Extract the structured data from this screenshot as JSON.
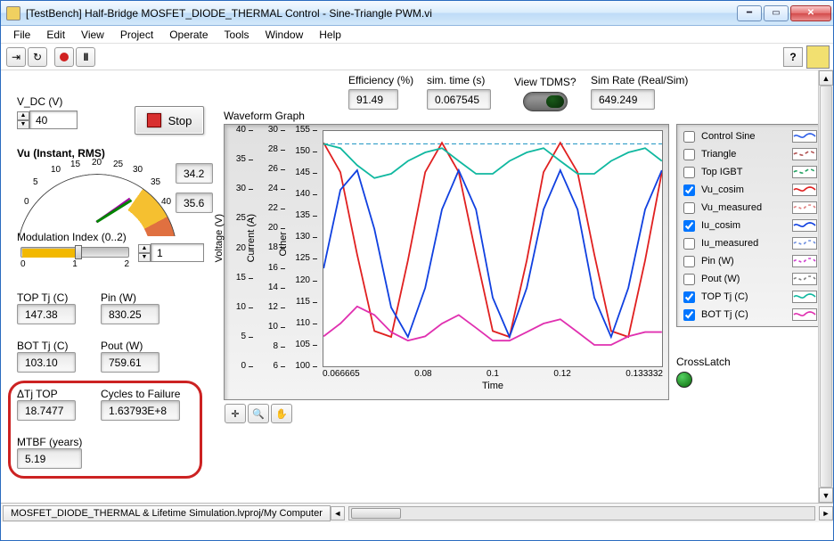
{
  "window": {
    "title": "[TestBench] Half-Bridge MOSFET_DIODE_THERMAL Control - Sine-Triangle PWM.vi"
  },
  "menu": [
    "File",
    "Edit",
    "View",
    "Project",
    "Operate",
    "Tools",
    "Window",
    "Help"
  ],
  "header": {
    "eff_label": "Efficiency (%)",
    "eff": "91.49",
    "simt_label": "sim. time (s)",
    "simt": "0.067545",
    "tdms_label": "View TDMS?",
    "rate_label": "Sim Rate (Real/Sim)",
    "rate": "649.249"
  },
  "left": {
    "vdc_label": "V_DC (V)",
    "vdc": "40",
    "stop": "Stop",
    "vu_title": "Vu (Instant, RMS)",
    "vu_a": "34.2",
    "vu_b": "35.6",
    "gauge_ticks": [
      "0",
      "5",
      "10",
      "15",
      "20",
      "25",
      "30",
      "35",
      "40"
    ],
    "mi_label": "Modulation Index (0..2)",
    "mi": "1",
    "mi_ticks": [
      "0",
      "1",
      "2"
    ],
    "toptj_label": "TOP Tj (C)",
    "toptj": "147.38",
    "pin_label": "Pin (W)",
    "pin": "830.25",
    "bottj_label": "BOT Tj (C)",
    "bottj": "103.10",
    "pout_label": "Pout (W)",
    "pout": "759.61",
    "dtj_label": "ΔTj TOP",
    "dtj": "18.7477",
    "cycles_label": "Cycles to Failure",
    "cycles": "1.63793E+8",
    "mtbf_label": "MTBF (years)",
    "mtbf": "5.19"
  },
  "graph": {
    "title": "Waveform Graph",
    "y1_name": "Voltage (V)",
    "y1": [
      "40",
      "35",
      "30",
      "25",
      "20",
      "15",
      "10",
      "5",
      "0"
    ],
    "y2_name": "Current (A)",
    "y2": [
      "30",
      "28",
      "26",
      "24",
      "22",
      "20",
      "18",
      "16",
      "14",
      "12",
      "10",
      "8",
      "6"
    ],
    "y3_name": "Other",
    "y3": [
      "155",
      "150",
      "145",
      "140",
      "135",
      "130",
      "125",
      "120",
      "115",
      "110",
      "105",
      "100"
    ],
    "xticks": [
      "0.066665",
      "0.08",
      "0.1",
      "0.12",
      "0.133332"
    ],
    "xlabel": "Time",
    "crosslatch_label": "CrossLatch"
  },
  "legend": [
    {
      "name": "Control Sine",
      "checked": false,
      "col": "#3060e8",
      "dash": ""
    },
    {
      "name": "Triangle",
      "checked": false,
      "col": "#b05050",
      "dash": "4 3"
    },
    {
      "name": "Top IGBT",
      "checked": false,
      "col": "#20a060",
      "dash": "4 3"
    },
    {
      "name": "Vu_cosim",
      "checked": true,
      "col": "#e02020",
      "dash": ""
    },
    {
      "name": "Vu_measured",
      "checked": false,
      "col": "#e08080",
      "dash": "3 3"
    },
    {
      "name": "Iu_cosim",
      "checked": true,
      "col": "#1040e0",
      "dash": ""
    },
    {
      "name": "Iu_measured",
      "checked": false,
      "col": "#7090e0",
      "dash": "3 3"
    },
    {
      "name": "Pin (W)",
      "checked": false,
      "col": "#d040d0",
      "dash": "3 3"
    },
    {
      "name": "Pout (W)",
      "checked": false,
      "col": "#808080",
      "dash": "3 3"
    },
    {
      "name": "TOP Tj (C)",
      "checked": true,
      "col": "#10b8a0",
      "dash": ""
    },
    {
      "name": "BOT Tj (C)",
      "checked": true,
      "col": "#e030b0",
      "dash": ""
    }
  ],
  "status": "MOSFET_DIODE_THERMAL & Lifetime Simulation.lvproj/My Computer",
  "chart_data": {
    "type": "line",
    "xlabel": "Time",
    "xlim": [
      0.066665,
      0.133332
    ],
    "axes": [
      {
        "name": "Voltage (V)",
        "range": [
          0,
          40
        ]
      },
      {
        "name": "Current (A)",
        "range": [
          6,
          30
        ]
      },
      {
        "name": "Other",
        "range": [
          100,
          155
        ]
      }
    ],
    "x": [
      0.0667,
      0.07,
      0.0733,
      0.0767,
      0.08,
      0.0833,
      0.0867,
      0.09,
      0.0933,
      0.0967,
      0.1,
      0.1033,
      0.1067,
      0.11,
      0.1133,
      0.1167,
      0.12,
      0.1233,
      0.1267,
      0.13,
      0.1333
    ],
    "series": [
      {
        "name": "Vu_cosim",
        "axis": 0,
        "y": [
          38,
          33,
          19,
          6,
          5,
          18,
          33,
          38,
          33,
          19,
          6,
          5,
          18,
          33,
          38,
          33,
          19,
          6,
          5,
          18,
          33
        ]
      },
      {
        "name": "Iu_cosim",
        "axis": 1,
        "y": [
          16,
          24,
          26,
          20,
          12,
          9,
          14,
          22,
          26,
          22,
          13,
          9,
          14,
          22,
          26,
          22,
          13,
          9,
          14,
          22,
          26
        ]
      },
      {
        "name": "TOP Tj (C)",
        "axis": 2,
        "y": [
          152,
          151,
          147,
          144,
          145,
          148,
          150,
          151,
          148,
          145,
          145,
          148,
          150,
          151,
          148,
          145,
          145,
          148,
          150,
          151,
          148
        ]
      },
      {
        "name": "BOT Tj (C)",
        "axis": 2,
        "y": [
          107,
          110,
          114,
          112,
          108,
          106,
          107,
          110,
          112,
          109,
          106,
          106,
          108,
          110,
          111,
          108,
          105,
          105,
          107,
          108,
          108
        ]
      }
    ]
  }
}
